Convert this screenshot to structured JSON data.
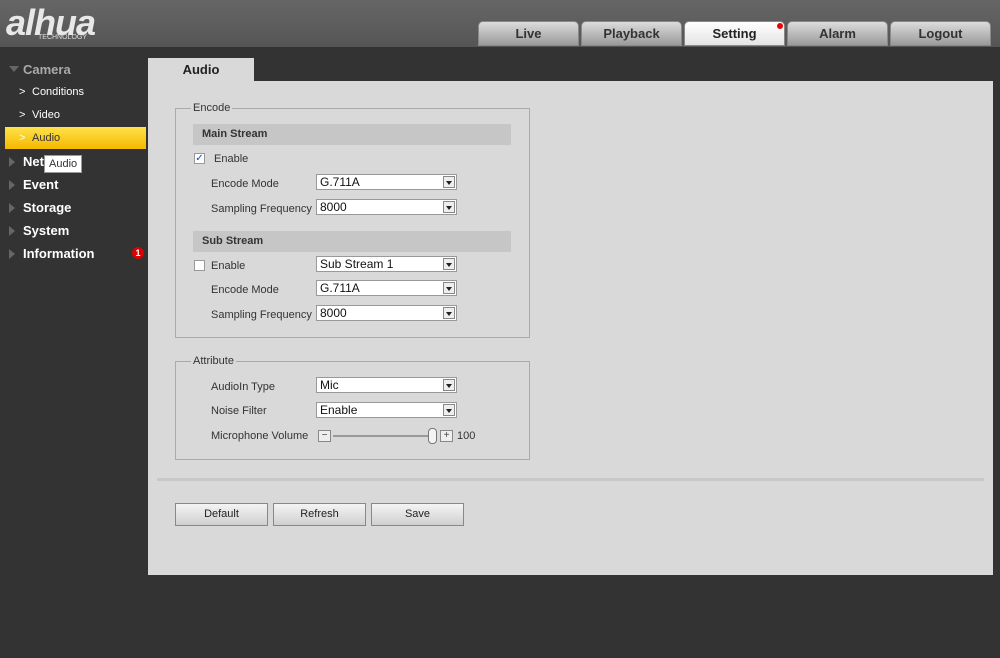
{
  "logo": {
    "text": "alhua",
    "sub": "TECHNOLOGY"
  },
  "nav": {
    "tabs": [
      {
        "label": "Live"
      },
      {
        "label": "Playback"
      },
      {
        "label": "Setting",
        "active": true
      },
      {
        "label": "Alarm"
      },
      {
        "label": "Logout"
      }
    ]
  },
  "sidebar": {
    "camera": "Camera",
    "conditions": "Conditions",
    "video": "Video",
    "audio": "Audio",
    "network": "Net",
    "event": "Event",
    "storage": "Storage",
    "system": "System",
    "information": "Information",
    "info_badge": "1",
    "tooltip": "Audio"
  },
  "page": {
    "tab": "Audio"
  },
  "encode": {
    "legend": "Encode",
    "main": {
      "title": "Main Stream",
      "enable_label": "Enable",
      "enabled": true,
      "encode_mode_label": "Encode Mode",
      "encode_mode": "G.711A",
      "sampling_label": "Sampling Frequency",
      "sampling": "8000"
    },
    "sub": {
      "title": "Sub Stream",
      "enable_label": "Enable",
      "enabled": false,
      "stream": "Sub Stream 1",
      "encode_mode_label": "Encode Mode",
      "encode_mode": "G.711A",
      "sampling_label": "Sampling Frequency",
      "sampling": "8000"
    }
  },
  "attribute": {
    "legend": "Attribute",
    "audioin_label": "AudioIn Type",
    "audioin": "Mic",
    "noise_label": "Noise Filter",
    "noise": "Enable",
    "volume_label": "Microphone Volume",
    "volume": "100"
  },
  "buttons": {
    "default": "Default",
    "refresh": "Refresh",
    "save": "Save"
  },
  "colors": {
    "selected": "#f5c400",
    "badge": "#dd0000"
  }
}
